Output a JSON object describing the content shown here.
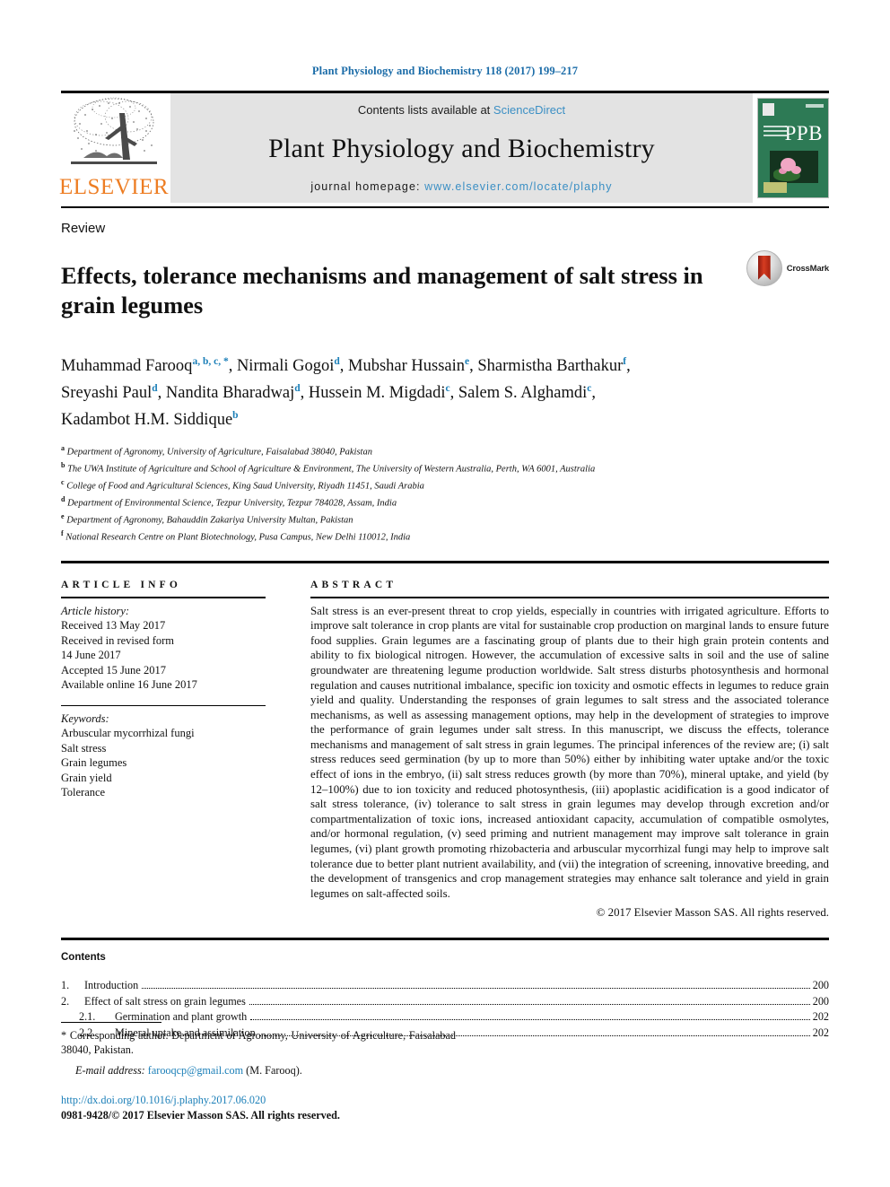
{
  "running_head": "Plant Physiology and Biochemistry 118 (2017) 199–217",
  "masthead": {
    "publisher_logo_label": "ELSEVIER",
    "contents_prefix": "Contents lists available at",
    "contents_link": "ScienceDirect",
    "journal_name": "Plant Physiology and Biochemistry",
    "homepage_prefix": "journal homepage:",
    "homepage_url": "www.elsevier.com/locate/plaphy",
    "cover_title": "PPB"
  },
  "article": {
    "category": "Review",
    "title": "Effects, tolerance mechanisms and management of salt stress in grain legumes",
    "crossmark_label": "CrossMark",
    "authors_line1_a": "Muhammad Farooq",
    "authors_line1_a_sup": "a, b, c, *",
    "authors_line1_b": ", Nirmali Gogoi",
    "authors_line1_b_sup": "d",
    "authors_line1_c": ", Mubshar Hussain",
    "authors_line1_c_sup": "e",
    "authors_line1_d": ", Sharmistha Barthakur",
    "authors_line1_d_sup": "f",
    "authors_line2_a": "Sreyashi Paul",
    "authors_line2_a_sup": "d",
    "authors_line2_b": ", Nandita Bharadwaj",
    "authors_line2_b_sup": "d",
    "authors_line2_c": ", Hussein M. Migdadi",
    "authors_line2_c_sup": "c",
    "authors_line2_d": ", Salem S. Alghamdi",
    "authors_line2_d_sup": "c",
    "authors_line3_a": "Kadambot H.M. Siddique",
    "authors_line3_a_sup": "b",
    "affiliations": [
      {
        "mark": "a",
        "text": "Department of Agronomy, University of Agriculture, Faisalabad 38040, Pakistan"
      },
      {
        "mark": "b",
        "text": "The UWA Institute of Agriculture and School of Agriculture & Environment, The University of Western Australia, Perth, WA 6001, Australia"
      },
      {
        "mark": "c",
        "text": "College of Food and Agricultural Sciences, King Saud University, Riyadh 11451, Saudi Arabia"
      },
      {
        "mark": "d",
        "text": "Department of Environmental Science, Tezpur University, Tezpur 784028, Assam, India"
      },
      {
        "mark": "e",
        "text": "Department of Agronomy, Bahauddin Zakariya University Multan, Pakistan"
      },
      {
        "mark": "f",
        "text": "National Research Centre on Plant Biotechnology, Pusa Campus, New Delhi 110012, India"
      }
    ]
  },
  "article_info": {
    "heading": "ARTICLE INFO",
    "history_label": "Article history:",
    "history": [
      "Received 13 May 2017",
      "Received in revised form",
      "14 June 2017",
      "Accepted 15 June 2017",
      "Available online 16 June 2017"
    ],
    "keywords_label": "Keywords:",
    "keywords": [
      "Arbuscular mycorrhizal fungi",
      "Salt stress",
      "Grain legumes",
      "Grain yield",
      "Tolerance"
    ]
  },
  "abstract": {
    "heading": "ABSTRACT",
    "body": "Salt stress is an ever-present threat to crop yields, especially in countries with irrigated agriculture. Efforts to improve salt tolerance in crop plants are vital for sustainable crop production on marginal lands to ensure future food supplies. Grain legumes are a fascinating group of plants due to their high grain protein contents and ability to fix biological nitrogen. However, the accumulation of excessive salts in soil and the use of saline groundwater are threatening legume production worldwide. Salt stress disturbs photosynthesis and hormonal regulation and causes nutritional imbalance, specific ion toxicity and osmotic effects in legumes to reduce grain yield and quality. Understanding the responses of grain legumes to salt stress and the associated tolerance mechanisms, as well as assessing management options, may help in the development of strategies to improve the performance of grain legumes under salt stress. In this manuscript, we discuss the effects, tolerance mechanisms and management of salt stress in grain legumes. The principal inferences of the review are; (i) salt stress reduces seed germination (by up to more than 50%) either by inhibiting water uptake and/or the toxic effect of ions in the embryo, (ii) salt stress reduces growth (by more than 70%), mineral uptake, and yield (by 12–100%) due to ion toxicity and reduced photosynthesis, (iii) apoplastic acidification is a good indicator of salt stress tolerance, (iv) tolerance to salt stress in grain legumes may develop through excretion and/or compartmentalization of toxic ions, increased antioxidant capacity, accumulation of compatible osmolytes, and/or hormonal regulation, (v) seed priming and nutrient management may improve salt tolerance in grain legumes, (vi) plant growth promoting rhizobacteria and arbuscular mycorrhizal fungi may help to improve salt tolerance due to better plant nutrient availability, and (vii) the integration of screening, innovative breeding, and the development of transgenics and crop management strategies may enhance salt tolerance and yield in grain legumes on salt-affected soils.",
    "copyright": "© 2017 Elsevier Masson SAS. All rights reserved."
  },
  "contents": {
    "heading": "Contents",
    "entries": [
      {
        "num": "1.",
        "label": "Introduction",
        "page": "200",
        "sub": false
      },
      {
        "num": "2.",
        "label": "Effect of salt stress on grain legumes",
        "page": "200",
        "sub": false
      },
      {
        "num": "2.1.",
        "label": "Germination and plant growth",
        "page": "202",
        "sub": true
      },
      {
        "num": "2.2.",
        "label": "Mineral uptake and assimilation",
        "page": "202",
        "sub": true
      }
    ]
  },
  "footer": {
    "corresponding": "* Corresponding author. Department of Agronomy, University of Agriculture, Faisalabad 38040, Pakistan.",
    "email_label": "E-mail address:",
    "email": "farooqcp@gmail.com",
    "email_suffix": "(M. Farooq).",
    "doi": "http://dx.doi.org/10.1016/j.plaphy.2017.06.020",
    "issn": "0981-9428/© 2017 Elsevier Masson SAS. All rights reserved."
  },
  "colors": {
    "link_blue": "#1b7fb8",
    "masthead_link_blue": "#3b8fc4",
    "elsevier_orange": "#ed7d23",
    "cover_green": "#2d7a55",
    "masthead_bg": "#e3e3e3"
  }
}
